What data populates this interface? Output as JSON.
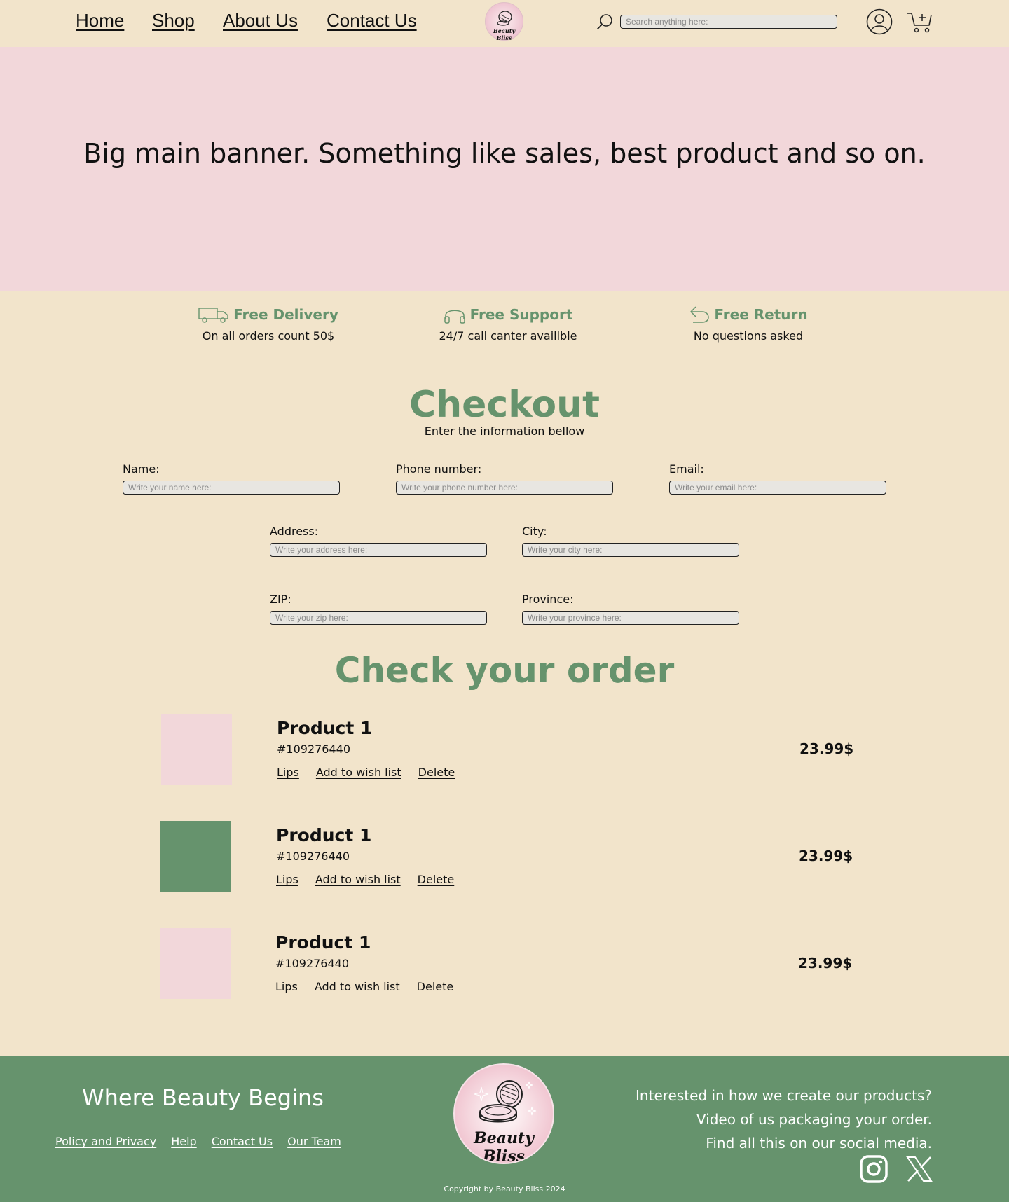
{
  "nav": {
    "home": "Home",
    "shop": "Shop",
    "about": "About Us",
    "contact": "Contact Us"
  },
  "brand": {
    "logo_text": "Beauty Bliss"
  },
  "search": {
    "placeholder": "Search anything here:"
  },
  "banner": {
    "text": "Big main banner. Something like sales, best product and so on."
  },
  "features": [
    {
      "icon": "truck-icon",
      "title": "Free Delivery",
      "subtitle": "On all orders count 50$"
    },
    {
      "icon": "headphones-icon",
      "title": "Free Support",
      "subtitle": "24/7 call canter availlble"
    },
    {
      "icon": "return-arrow-icon",
      "title": "Free Return",
      "subtitle": "No questions asked"
    }
  ],
  "checkout": {
    "title": "Checkout",
    "subtitle": "Enter the information bellow",
    "fields": {
      "name": {
        "label": "Name:",
        "placeholder": "Write your name here:"
      },
      "phone": {
        "label": "Phone number:",
        "placeholder": "Write your phone number here:"
      },
      "email": {
        "label": "Email:",
        "placeholder": "Write your email here:"
      },
      "address": {
        "label": "Address:",
        "placeholder": "Write your address here:"
      },
      "city": {
        "label": "City:",
        "placeholder": "Write your city here:"
      },
      "zip": {
        "label": "ZIP:",
        "placeholder": "Write your zip here:"
      },
      "province": {
        "label": "Province:",
        "placeholder": "Write your province here:"
      }
    }
  },
  "order": {
    "title": "Check your order",
    "items": [
      {
        "name": "Product 1",
        "sku": "#109276440",
        "category": "Lips",
        "wishlist": "Add to wish list",
        "delete": "Delete",
        "price": "23.99$",
        "thumb_color": "#f2d7da"
      },
      {
        "name": "Product 1",
        "sku": "#109276440",
        "category": "Lips",
        "wishlist": "Add to wish list",
        "delete": "Delete",
        "price": "23.99$",
        "thumb_color": "#66936d"
      },
      {
        "name": "Product 1",
        "sku": "#109276440",
        "category": "Lips",
        "wishlist": "Add to wish list",
        "delete": "Delete",
        "price": "23.99$",
        "thumb_color": "#f2d7da"
      }
    ]
  },
  "footer": {
    "tagline": "Where Beauty Begins",
    "links": [
      "Policy and Privacy",
      "Help",
      "Contact Us",
      "Our Team"
    ],
    "social_lines": [
      "Interested in how we create our products?",
      "Video of us packaging your order.",
      "Find all this on our social media."
    ],
    "social_icons": [
      "instagram-icon",
      "x-icon"
    ],
    "copyright": "Copyright by Beauty Bliss 2024"
  },
  "colors": {
    "background": "#f2e4cb",
    "banner": "#f2d7da",
    "accent_green": "#66936d",
    "input_bg": "#e8e6e1"
  }
}
